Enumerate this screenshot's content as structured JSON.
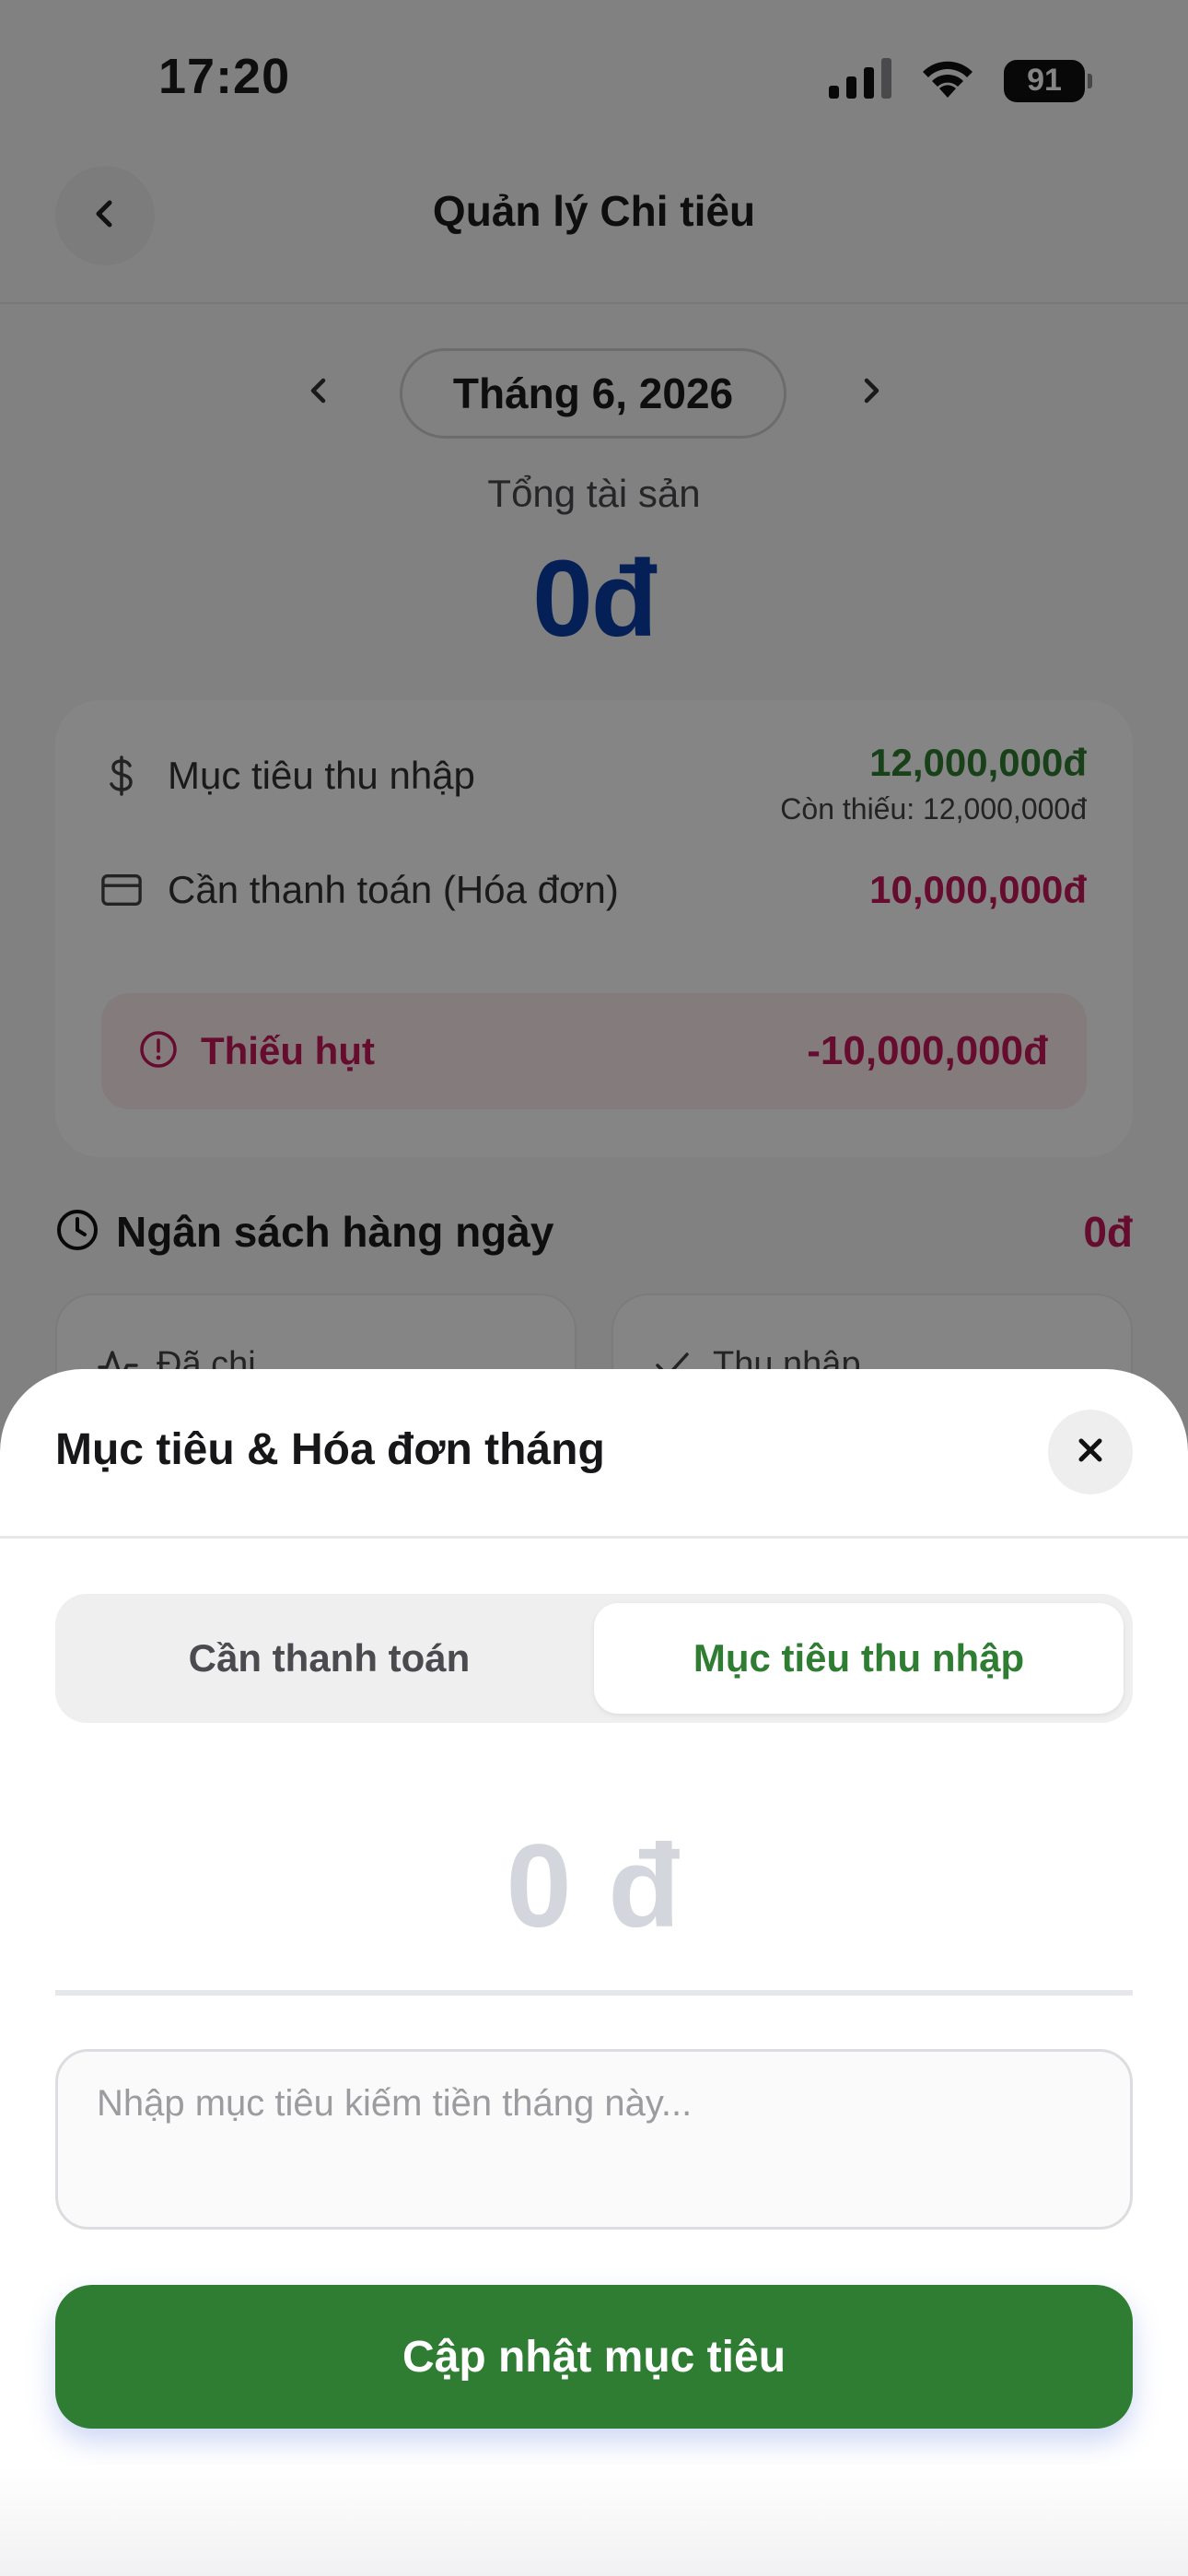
{
  "status_bar": {
    "time": "17:20",
    "battery": "91"
  },
  "header": {
    "title": "Quản lý Chi tiêu"
  },
  "month_nav": {
    "current": "Tháng 6, 2026"
  },
  "assets": {
    "label": "Tổng tài sản",
    "value": "0đ"
  },
  "summary": {
    "income_goal": {
      "label": "Mục tiêu thu nhập",
      "value": "12,000,000đ",
      "note": "Còn thiếu: 12,000,000đ"
    },
    "bills": {
      "label": "Cần thanh toán (Hóa đơn)",
      "value": "10,000,000đ"
    },
    "deficit": {
      "label": "Thiếu hụt",
      "value": "-10,000,000đ"
    }
  },
  "daily_budget": {
    "title": "Ngân sách hàng ngày",
    "value": "0đ",
    "spent_label": "Đã chi",
    "income_label": "Thu nhập"
  },
  "sheet": {
    "title": "Mục tiêu & Hóa đơn tháng",
    "tabs": [
      {
        "label": "Cần thanh toán",
        "active": false
      },
      {
        "label": "Mục tiêu thu nhập",
        "active": true
      }
    ],
    "amount": "0 đ",
    "note_placeholder": "Nhập mục tiêu kiếm tiền tháng này...",
    "submit_label": "Cập nhật mục tiêu"
  },
  "colors": {
    "primary_green": "#2e7d32",
    "accent_red": "#c2185b",
    "asset_blue": "#0a3fa8"
  }
}
